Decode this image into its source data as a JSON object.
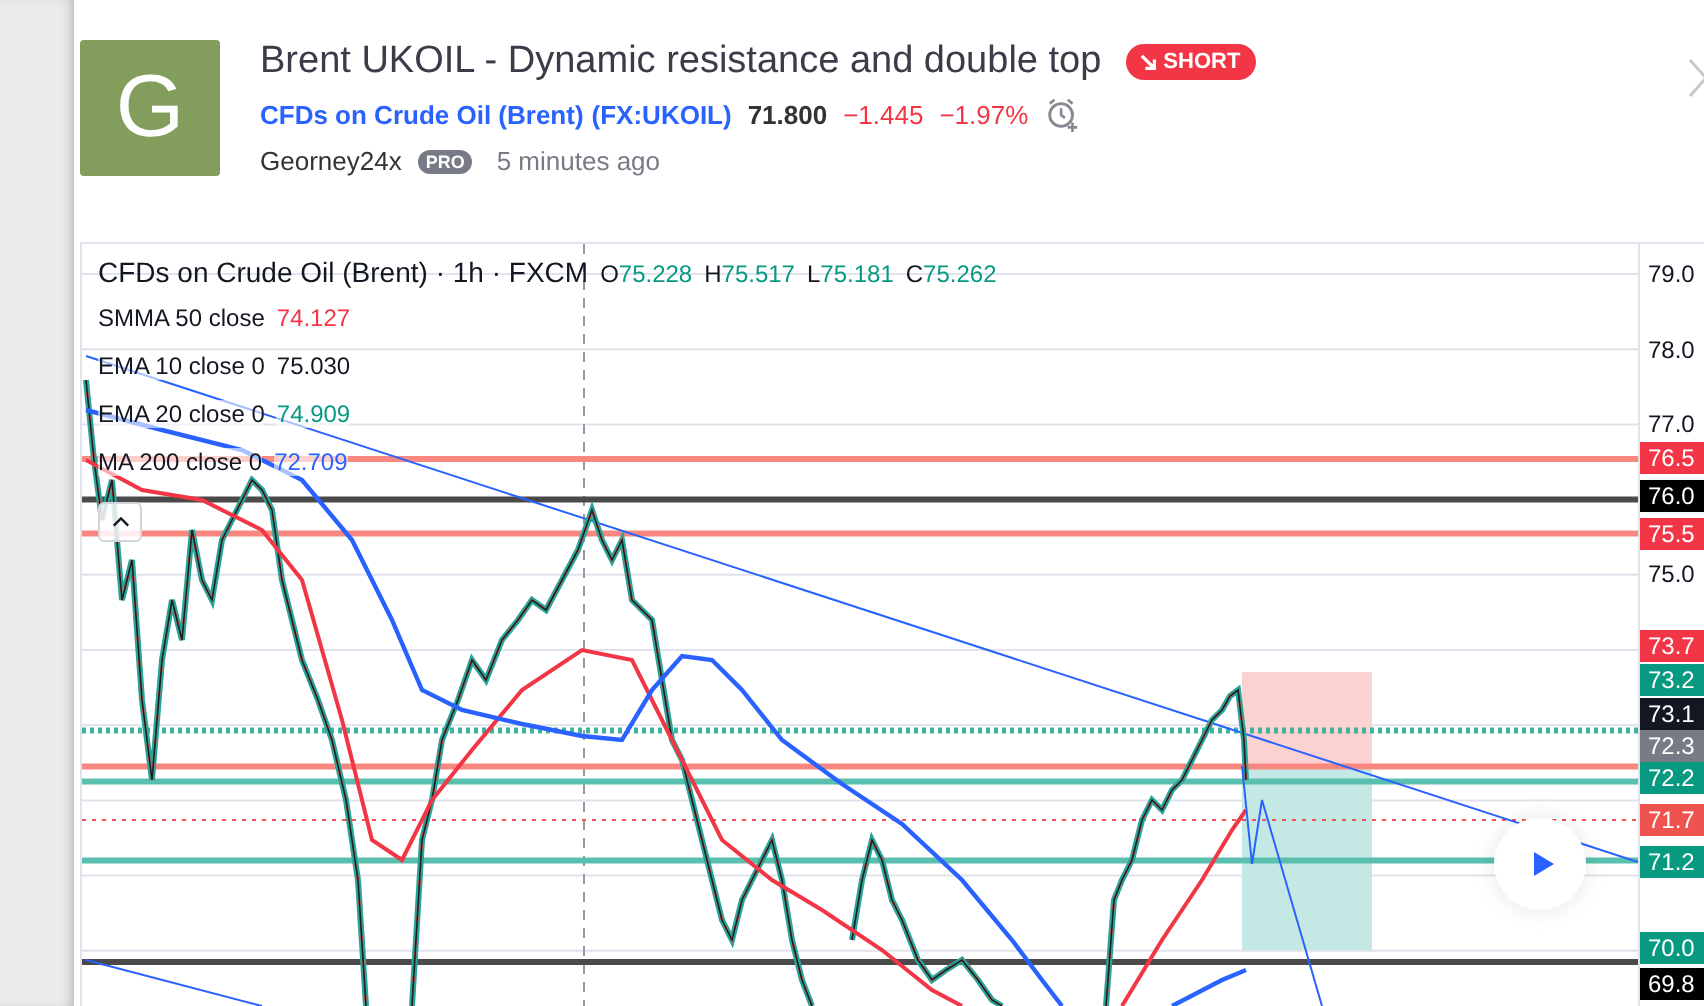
{
  "idea": {
    "avatar_letter": "G",
    "title": "Brent UKOIL - Dynamic resistance and double top",
    "direction": {
      "kind": "short",
      "label": "SHORT"
    },
    "instrument": "CFDs on Crude Oil (Brent)",
    "symbol": "(FX:UKOIL)",
    "price": "71.800",
    "change": "−1.445",
    "change_percent": "−1.97%",
    "author": "Georney24x",
    "author_badge": "PRO",
    "time": "5 minutes ago"
  },
  "chart": {
    "header": "CFDs on Crude Oil (Brent) · 1h · FXCM",
    "ohlc": [
      {
        "label": "O",
        "value": "75.228"
      },
      {
        "label": "H",
        "value": "75.517"
      },
      {
        "label": "L",
        "value": "75.181"
      },
      {
        "label": "C",
        "value": "75.262"
      }
    ],
    "indicators": [
      {
        "name": "SMMA 50 close",
        "value": "74.127",
        "color": "#f23645"
      },
      {
        "name": "EMA 10 close 0",
        "value": "75.030",
        "color": "#131722"
      },
      {
        "name": "EMA 20 close 0",
        "value": "74.909",
        "color": "#089981"
      },
      {
        "name": "MA 200 close 0",
        "value": "72.709",
        "color": "#2962ff"
      }
    ],
    "price_axis": [
      {
        "text": "79.0",
        "kind": "tick"
      },
      {
        "text": "78.0",
        "kind": "tick"
      },
      {
        "text": "77.0",
        "kind": "tick"
      },
      {
        "text": "76.5",
        "kind": "tag",
        "color": "#f23645"
      },
      {
        "text": "76.0",
        "kind": "tag",
        "color": "#000000"
      },
      {
        "text": "75.5",
        "kind": "tag",
        "color": "#f23645"
      },
      {
        "text": "75.0",
        "kind": "tick"
      },
      {
        "text": "73.7",
        "kind": "tag",
        "color": "#f23645"
      },
      {
        "text": "73.2",
        "kind": "tag",
        "color": "#089981"
      },
      {
        "text": "73.1",
        "kind": "tag",
        "color": "#131722"
      },
      {
        "text": "72.3",
        "kind": "tag",
        "color": "#787b86"
      },
      {
        "text": "72.2",
        "kind": "tag",
        "color": "#089981"
      },
      {
        "text": "71.7",
        "kind": "tag",
        "color": "#ef5350"
      },
      {
        "text": "71.2",
        "kind": "tag",
        "color": "#089981"
      },
      {
        "text": "70.0",
        "kind": "tag",
        "color": "#089981"
      },
      {
        "text": "69.8",
        "kind": "tag",
        "color": "#000000"
      }
    ]
  }
}
